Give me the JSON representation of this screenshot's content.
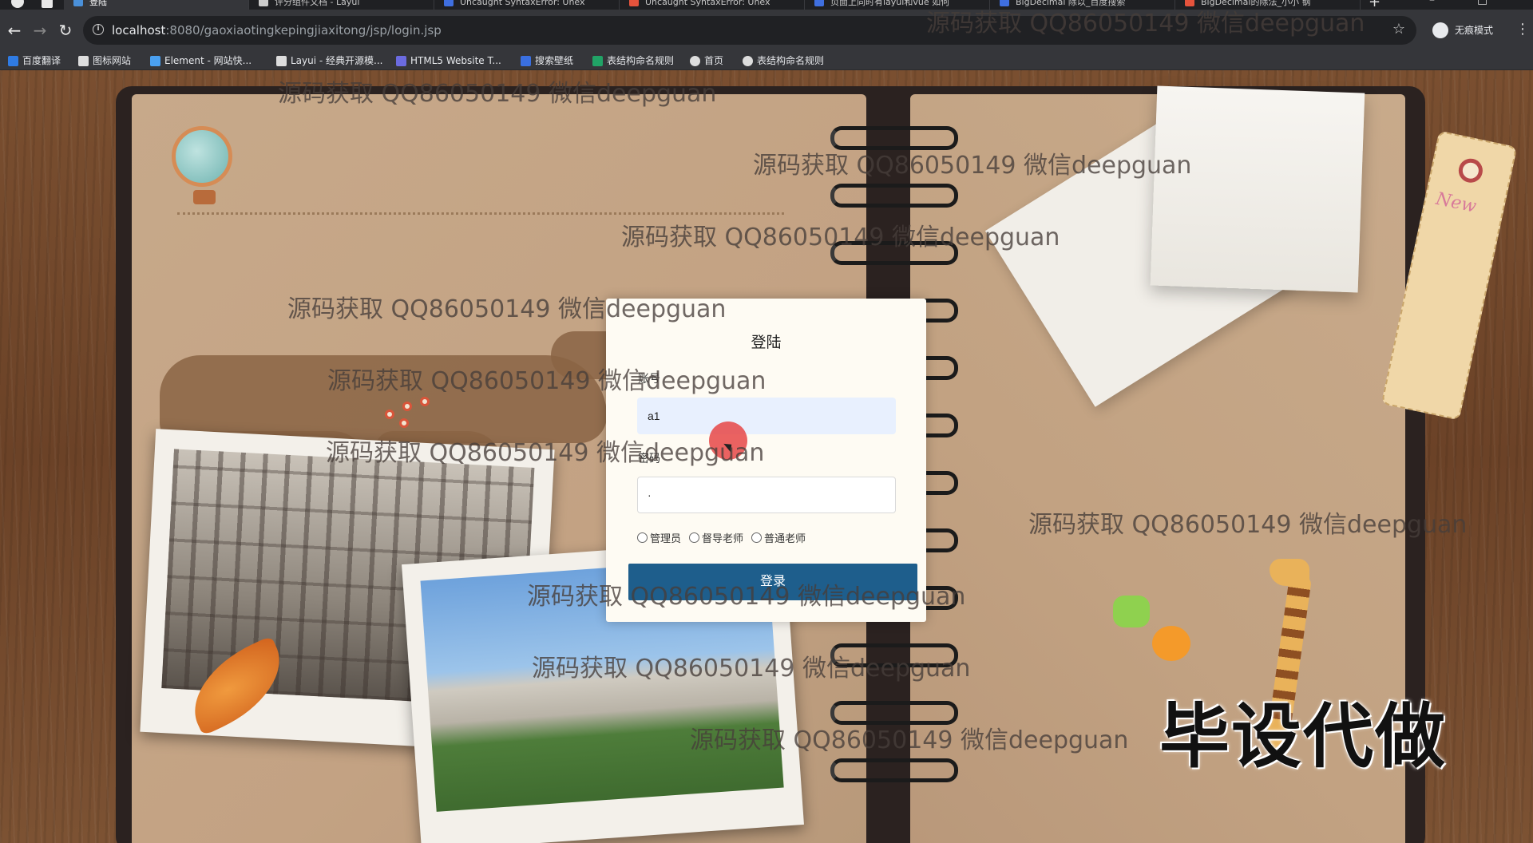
{
  "browser": {
    "tabs": [
      {
        "label": "登陆",
        "active": true,
        "favicon_color": "#4a90d9"
      },
      {
        "label": "评分组件文档 - Layui",
        "active": false,
        "favicon_color": "#cccccc"
      },
      {
        "label": "Uncaught SyntaxError: Unex",
        "active": false,
        "favicon_color": "#3f6fe0"
      },
      {
        "label": "Uncaught SyntaxError: Unex",
        "active": false,
        "favicon_color": "#e5533c"
      },
      {
        "label": "页面上同时有layui和vue 如何",
        "active": false,
        "favicon_color": "#3f6fe0"
      },
      {
        "label": "BigDecimal 除以_百度搜索",
        "active": false,
        "favicon_color": "#3f6fe0"
      },
      {
        "label": "BigDecimal的除法_小小 钢",
        "active": false,
        "favicon_color": "#e5533c"
      }
    ],
    "new_tab_icon": "plus-icon",
    "url_host": "localhost",
    "url_rest": ":8080/gaoxiaotingkepingjiaxitong/jsp/login.jsp",
    "incognito_label": "无痕模式",
    "bookmarks": [
      {
        "label": "百度翻译",
        "color": "#2f7be3"
      },
      {
        "label": "图标网站",
        "color": "#dddddd"
      },
      {
        "label": "Element - 网站快...",
        "color": "#4aa0f0"
      },
      {
        "label": "Layui - 经典开源模...",
        "color": "#dddddd"
      },
      {
        "label": "HTML5 Website T...",
        "color": "#6b6be0"
      },
      {
        "label": "搜索壁纸",
        "color": "#3a6fe0"
      },
      {
        "label": "表结构命名规则",
        "color": "#21a366"
      },
      {
        "label": "首页",
        "color": "#dddddd"
      },
      {
        "label": "表结构命名规则",
        "color": "#dddddd"
      }
    ]
  },
  "login": {
    "title": "登陆",
    "username_label": "账号",
    "username_value": "a1",
    "password_label": "密码",
    "password_value": "·",
    "roles": [
      "管理员",
      "督导老师",
      "普通老师"
    ],
    "submit_label": "登录"
  },
  "watermark_text": "源码获取 QQ86050149 微信deepguan",
  "promo_text": "毕设代做",
  "tag_text": "New"
}
